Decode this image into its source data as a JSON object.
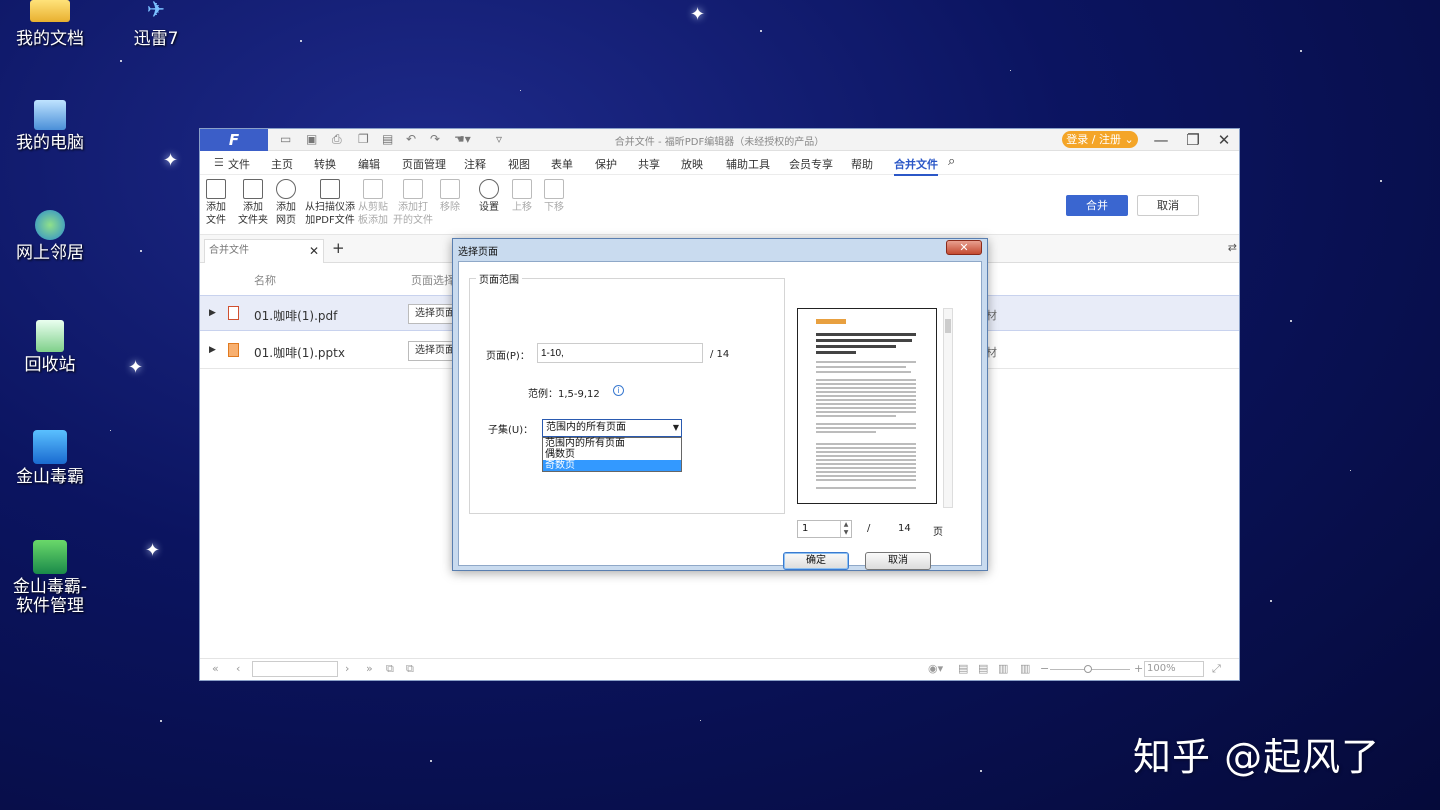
{
  "desktop": {
    "icons": [
      {
        "name": "desktop-icon-my-documents",
        "label": "我的文档"
      },
      {
        "name": "desktop-icon-xunlei",
        "label": "迅雷7"
      },
      {
        "name": "desktop-icon-my-computer",
        "label": "我的电脑"
      },
      {
        "name": "desktop-icon-network",
        "label": "网上邻居"
      },
      {
        "name": "desktop-icon-recycle-bin",
        "label": "回收站"
      },
      {
        "name": "desktop-icon-kingsoft-av",
        "label": "金山毒霸"
      },
      {
        "name": "desktop-icon-kingsoft-softmgr",
        "label1": "金山毒霸-",
        "label2": "软件管理"
      }
    ]
  },
  "window": {
    "logo": "F",
    "title": "合并文件 - 福昕PDF编辑器（未经授权的产品）",
    "login_label": "登录 / 注册",
    "menu": [
      "文件",
      "主页",
      "转换",
      "编辑",
      "页面管理",
      "注释",
      "视图",
      "表单",
      "保护",
      "共享",
      "放映",
      "辅助工具",
      "会员专享",
      "帮助",
      "合并文件"
    ],
    "ribbon": {
      "add_file": [
        "添加",
        "文件"
      ],
      "add_folder": [
        "添加",
        "文件夹"
      ],
      "add_web": [
        "添加",
        "网页"
      ],
      "add_scan": [
        "从扫描仪添",
        "加PDF文件"
      ],
      "from_clipboard": [
        "从剪贴",
        "板添加"
      ],
      "add_open": [
        "添加打",
        "开的文件"
      ],
      "remove": "移除",
      "settings": "设置",
      "move_up": "上移",
      "move_down": "下移",
      "merge": "合并",
      "cancel": "取消"
    },
    "tab_label": "合并文件",
    "columns": {
      "name": "名称",
      "page_select": "页面选择"
    },
    "files": [
      {
        "name": "01.咖啡(1).pdf",
        "select": "选择页面",
        "tail": "材"
      },
      {
        "name": "01.咖啡(1).pptx",
        "select": "选择页面",
        "tail": "材"
      }
    ],
    "status": {
      "zoom": "100%"
    }
  },
  "dialog": {
    "title": "选择页面",
    "group_title": "页面范围",
    "page_label": "页面(P)：",
    "page_value": "1-10,",
    "total": "/ 14",
    "example": "范例：1,5-9,12",
    "subset_label": "子集(U)：",
    "subset_value": "范围内的所有页面",
    "subset_options": [
      "范围内的所有页面",
      "偶数页",
      "奇数页"
    ],
    "preview_page": "1",
    "preview_slash": "/",
    "preview_total": "14",
    "preview_unit": "页",
    "ok": "确定",
    "cancel": "取消"
  },
  "watermark": "知乎 @起风了"
}
